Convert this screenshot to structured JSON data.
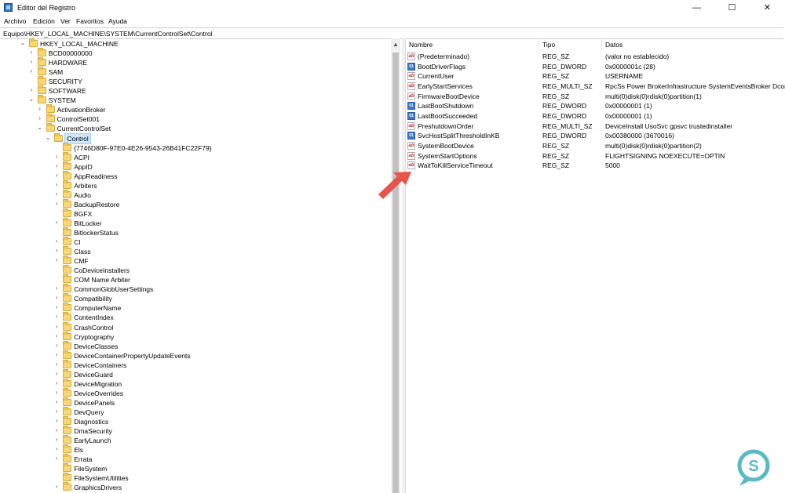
{
  "window": {
    "title": "Editor del Registro",
    "minimize": "—",
    "maximize": "☐",
    "close": "✕"
  },
  "menu": {
    "items": [
      "Archivo",
      "Edición",
      "Ver",
      "Favoritos",
      "Ayuda"
    ]
  },
  "address": {
    "path": "Equipo\\HKEY_LOCAL_MACHINE\\SYSTEM\\CurrentControlSet\\Control"
  },
  "tree": {
    "items": [
      {
        "label": "HKEY_LOCAL_MACHINE",
        "level": 0,
        "state": "expanded"
      },
      {
        "label": "BCD00000000",
        "level": 1,
        "state": "collapsed"
      },
      {
        "label": "HARDWARE",
        "level": 1,
        "state": "collapsed"
      },
      {
        "label": "SAM",
        "level": 1,
        "state": "collapsed"
      },
      {
        "label": "SECURITY",
        "level": 1,
        "state": "none"
      },
      {
        "label": "SOFTWARE",
        "level": 1,
        "state": "collapsed"
      },
      {
        "label": "SYSTEM",
        "level": 1,
        "state": "expanded"
      },
      {
        "label": "ActivationBroker",
        "level": 2,
        "state": "collapsed"
      },
      {
        "label": "ControlSet001",
        "level": 2,
        "state": "collapsed"
      },
      {
        "label": "CurrentControlSet",
        "level": 2,
        "state": "expanded"
      },
      {
        "label": "Control",
        "level": 3,
        "state": "expanded",
        "selected": true
      },
      {
        "label": "{7746D80F-97E0-4E26-9543-26B41FC22F79}",
        "level": 4,
        "state": "none"
      },
      {
        "label": "ACPI",
        "level": 4,
        "state": "collapsed"
      },
      {
        "label": "AppID",
        "level": 4,
        "state": "collapsed"
      },
      {
        "label": "AppReadiness",
        "level": 4,
        "state": "collapsed"
      },
      {
        "label": "Arbiters",
        "level": 4,
        "state": "collapsed"
      },
      {
        "label": "Audio",
        "level": 4,
        "state": "collapsed"
      },
      {
        "label": "BackupRestore",
        "level": 4,
        "state": "collapsed"
      },
      {
        "label": "BGFX",
        "level": 4,
        "state": "none"
      },
      {
        "label": "BitLocker",
        "level": 4,
        "state": "collapsed"
      },
      {
        "label": "BitlockerStatus",
        "level": 4,
        "state": "none"
      },
      {
        "label": "CI",
        "level": 4,
        "state": "collapsed"
      },
      {
        "label": "Class",
        "level": 4,
        "state": "collapsed"
      },
      {
        "label": "CMF",
        "level": 4,
        "state": "collapsed"
      },
      {
        "label": "CoDeviceInstallers",
        "level": 4,
        "state": "none"
      },
      {
        "label": "COM Name Arbiter",
        "level": 4,
        "state": "none"
      },
      {
        "label": "CommonGlobUserSettings",
        "level": 4,
        "state": "collapsed"
      },
      {
        "label": "Compatibility",
        "level": 4,
        "state": "collapsed"
      },
      {
        "label": "ComputerName",
        "level": 4,
        "state": "collapsed"
      },
      {
        "label": "ContentIndex",
        "level": 4,
        "state": "collapsed"
      },
      {
        "label": "CrashControl",
        "level": 4,
        "state": "collapsed"
      },
      {
        "label": "Cryptography",
        "level": 4,
        "state": "collapsed"
      },
      {
        "label": "DeviceClasses",
        "level": 4,
        "state": "collapsed"
      },
      {
        "label": "DeviceContainerPropertyUpdateEvents",
        "level": 4,
        "state": "collapsed"
      },
      {
        "label": "DeviceContainers",
        "level": 4,
        "state": "collapsed"
      },
      {
        "label": "DeviceGuard",
        "level": 4,
        "state": "collapsed"
      },
      {
        "label": "DeviceMigration",
        "level": 4,
        "state": "collapsed"
      },
      {
        "label": "DeviceOverrides",
        "level": 4,
        "state": "collapsed"
      },
      {
        "label": "DevicePanels",
        "level": 4,
        "state": "collapsed"
      },
      {
        "label": "DevQuery",
        "level": 4,
        "state": "collapsed"
      },
      {
        "label": "Diagnostics",
        "level": 4,
        "state": "collapsed"
      },
      {
        "label": "DmaSecurity",
        "level": 4,
        "state": "collapsed"
      },
      {
        "label": "EarlyLaunch",
        "level": 4,
        "state": "collapsed"
      },
      {
        "label": "Els",
        "level": 4,
        "state": "collapsed"
      },
      {
        "label": "Errata",
        "level": 4,
        "state": "collapsed"
      },
      {
        "label": "FileSystem",
        "level": 4,
        "state": "none"
      },
      {
        "label": "FileSystemUtilities",
        "level": 4,
        "state": "none"
      },
      {
        "label": "GraphicsDrivers",
        "level": 4,
        "state": "collapsed"
      }
    ]
  },
  "list": {
    "headers": {
      "name": "Nombre",
      "type": "Tipo",
      "data": "Datos"
    },
    "rows": [
      {
        "name": "(Predeterminado)",
        "type": "REG_SZ",
        "data": "(valor no establecido)",
        "icon": "string-value-icon"
      },
      {
        "name": "BootDriverFlags",
        "type": "REG_DWORD",
        "data": "0x0000001c (28)",
        "icon": "binary-value-icon"
      },
      {
        "name": "CurrentUser",
        "type": "REG_SZ",
        "data": "USERNAME",
        "icon": "string-value-icon"
      },
      {
        "name": "EarlyStartServices",
        "type": "REG_MULTI_SZ",
        "data": "RpcSs Power BrokerInfrastructure SystemEventsBroker DcomLaunch",
        "icon": "string-value-icon"
      },
      {
        "name": "FirmwareBootDevice",
        "type": "REG_SZ",
        "data": "multi(0)disk(0)rdisk(0)partition(1)",
        "icon": "string-value-icon"
      },
      {
        "name": "LastBootShutdown",
        "type": "REG_DWORD",
        "data": "0x00000001 (1)",
        "icon": "binary-value-icon"
      },
      {
        "name": "LastBootSucceeded",
        "type": "REG_DWORD",
        "data": "0x00000001 (1)",
        "icon": "binary-value-icon"
      },
      {
        "name": "PreshutdownOrder",
        "type": "REG_MULTI_SZ",
        "data": "DeviceInstall UsoSvc gpsvc trustedinstaller",
        "icon": "string-value-icon"
      },
      {
        "name": "SvcHostSplitThresholdInKB",
        "type": "REG_DWORD",
        "data": "0x00380000 (3670016)",
        "icon": "binary-value-icon"
      },
      {
        "name": "SystemBootDevice",
        "type": "REG_SZ",
        "data": "multi(0)disk(0)rdisk(0)partition(2)",
        "icon": "string-value-icon"
      },
      {
        "name": "SystemStartOptions",
        "type": "REG_SZ",
        "data": " FLIGHTSIGNING  NOEXECUTE=OPTIN",
        "icon": "string-value-icon"
      },
      {
        "name": "WaitToKillServiceTimeout",
        "type": "REG_SZ",
        "data": "5000",
        "icon": "string-value-icon"
      }
    ]
  },
  "colors": {
    "selection": "#cce8ff",
    "folder": "#f8d775",
    "arrow": "#e8534a",
    "watermark": "#5bb9c4"
  }
}
